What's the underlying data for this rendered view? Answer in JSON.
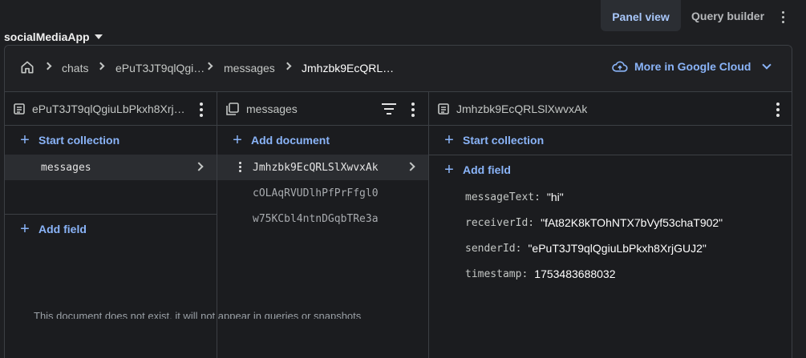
{
  "topbar": {
    "view_toggle": "Panel view",
    "query_builder": "Query builder",
    "project_name": "socialMediaApp"
  },
  "breadcrumb": {
    "items": [
      "chats",
      "ePuT3JT9qlQgi…",
      "messages",
      "Jmhzbk9EcQRL…"
    ],
    "cloud_link": "More in Google Cloud"
  },
  "col1": {
    "title": "ePuT3JT9qlQgiuLbPkxh8Xrj…",
    "start_collection": "Start collection",
    "collection_item": "messages",
    "add_field": "Add field",
    "note": "This document does not exist, it will not appear in queries or snapshots"
  },
  "col2": {
    "title": "messages",
    "add_document": "Add document",
    "documents": [
      "Jmhzbk9EcQRLSlXwvxAk",
      "cOLAqRVUDlhPfPrFfgl0",
      "w75KCbl4ntnDGqbTRe3a"
    ]
  },
  "col3": {
    "title": "Jmhzbk9EcQRLSlXwvxAk",
    "start_collection": "Start collection",
    "add_field": "Add field",
    "fields": [
      {
        "key": "messageText:",
        "value": "\"hi\""
      },
      {
        "key": "receiverId:",
        "value": "\"fAt82K8kTOhNTX7bVyf53chaT902\""
      },
      {
        "key": "senderId:",
        "value": "\"ePuT3JT9qlQgiuLbPkxh8XrjGUJ2\""
      },
      {
        "key": "timestamp:",
        "value": "1753483688032"
      }
    ]
  },
  "colors": {
    "accent": "#8ab4f8",
    "background": "#1b1c1f",
    "border": "#3c3f44"
  }
}
